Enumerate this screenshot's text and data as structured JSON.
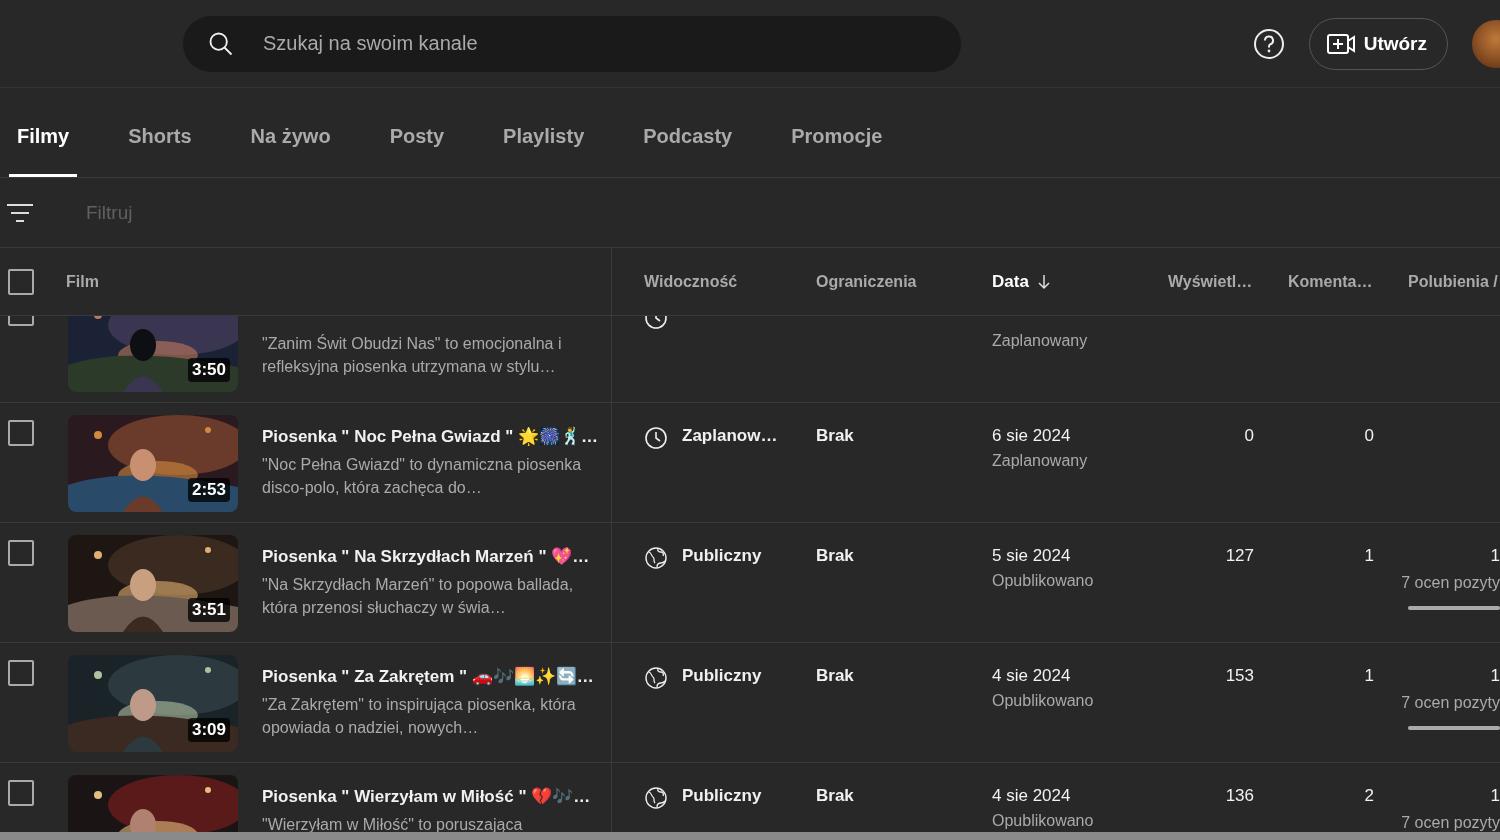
{
  "search": {
    "placeholder": "Szukaj na swoim kanale"
  },
  "header_actions": {
    "create_label": "Utwórz"
  },
  "tabs": [
    {
      "label": "Filmy",
      "selected": true
    },
    {
      "label": "Shorts",
      "selected": false
    },
    {
      "label": "Na żywo",
      "selected": false
    },
    {
      "label": "Posty",
      "selected": false
    },
    {
      "label": "Playlisty",
      "selected": false
    },
    {
      "label": "Podcasty",
      "selected": false
    },
    {
      "label": "Promocje",
      "selected": false
    }
  ],
  "filter": {
    "placeholder": "Filtruj"
  },
  "table": {
    "select_all_checked": false,
    "columns": [
      {
        "label": "Film",
        "sorted": false
      },
      {
        "label": "Widoczność",
        "sorted": false
      },
      {
        "label": "Ograniczenia",
        "sorted": false
      },
      {
        "label": "Data",
        "sorted": true
      },
      {
        "label": "Wyświetl…",
        "sorted": false
      },
      {
        "label": "Komenta…",
        "sorted": false
      },
      {
        "label": "Polubienia /",
        "sorted": false
      }
    ],
    "rows": [
      {
        "checked": false,
        "thumb": {
          "kind": "night",
          "duration": "3:50"
        },
        "description": "\"Zanim Świt Obudzi Nas\" to emocjonalna i refleksyjna piosenka utrzymana w stylu…",
        "visibility": {
          "kind": "scheduled"
        },
        "status": "Zaplanowany"
      },
      {
        "checked": false,
        "thumb": {
          "kind": "party",
          "duration": "2:53"
        },
        "title": "Piosenka \" Noc Pełna Gwiazd \" 🌟🎆🕺…",
        "description": "\"Noc Pełna Gwiazd\" to dynamiczna piosenka disco-polo, która zachęca do…",
        "visibility": {
          "kind": "scheduled",
          "label": "Zaplanow…"
        },
        "restrictions": "Brak",
        "date": "6 sie 2024",
        "status": "Zaplanowany",
        "views": "0",
        "comments": "0"
      },
      {
        "checked": false,
        "thumb": {
          "kind": "candles",
          "duration": "3:51"
        },
        "title": "Piosenka \" Na Skrzydłach Marzeń \" 💖…",
        "description": "\"Na Skrzydłach Marzeń\" to popowa ballada, która przenosi słuchaczy w świa…",
        "visibility": {
          "kind": "public",
          "label": "Publiczny"
        },
        "restrictions": "Brak",
        "date": "5 sie 2024",
        "status": "Opublikowano",
        "views": "127",
        "comments": "1",
        "likes": {
          "value": "1",
          "note": "7 ocen pozyty",
          "level": 1
        }
      },
      {
        "checked": false,
        "thumb": {
          "kind": "portrait",
          "duration": "3:09"
        },
        "title": "Piosenka \" Za Zakrętem \" 🚗🎶🌅✨🔄…",
        "description": "\"Za Zakrętem\" to inspirująca piosenka, która opowiada o nadziei, nowych…",
        "visibility": {
          "kind": "public",
          "label": "Publiczny"
        },
        "restrictions": "Brak",
        "date": "4 sie 2024",
        "status": "Opublikowano",
        "views": "153",
        "comments": "1",
        "likes": {
          "value": "1",
          "note": "7 ocen pozyty",
          "level": 1
        }
      },
      {
        "checked": false,
        "thumb": {
          "kind": "cinema"
        },
        "title": "Piosenka \" Wierzyłam w Miłość \" 💔🎶…",
        "description": "\"Wierzyłam w Miłość\" to poruszająca",
        "visibility": {
          "kind": "public",
          "label": "Publiczny"
        },
        "restrictions": "Brak",
        "date": "4 sie 2024",
        "status": "Opublikowano",
        "views": "136",
        "comments": "2",
        "likes": {
          "value": "1",
          "note": "7 ocen pozyty"
        }
      }
    ]
  }
}
